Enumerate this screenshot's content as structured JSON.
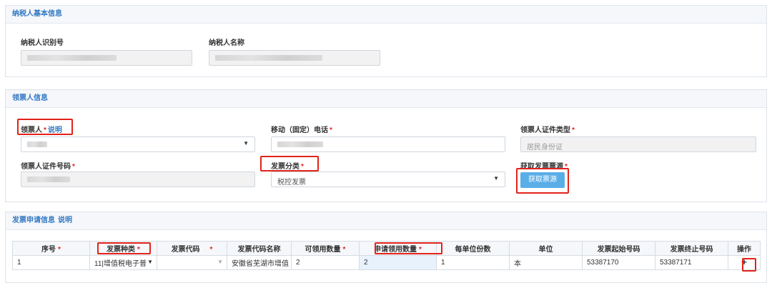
{
  "panels": {
    "taxpayer": {
      "title": "纳税人基本信息",
      "id_label": "纳税人识别号",
      "name_label": "纳税人名称"
    },
    "collector": {
      "title": "领票人信息",
      "collector_label": "领票人",
      "collector_note": "说明",
      "phone_label": "移动（固定）电话",
      "id_type_label": "领票人证件类型",
      "id_type_value": "居民身份证",
      "id_number_label": "领票人证件号码",
      "invoice_category_label": "发票分类",
      "invoice_category_value": "税控发票",
      "source_label": "获取发票票源",
      "source_button": "获取票源",
      "required_mark": "*"
    },
    "application": {
      "title": "发票申请信息",
      "title_link": "说明",
      "columns": [
        "序号",
        "发票种类",
        "发票代码",
        "发票代码名称",
        "可领用数量",
        "申请领用数量",
        "每单位份数",
        "单位",
        "发票起始号码",
        "发票终止号码",
        "操作"
      ],
      "rows": [
        {
          "index": "1",
          "invoice_type": "11|增值税电子普",
          "invoice_code": "",
          "code_name": "安徽省芜湖市增值",
          "available": "2",
          "requested": "2",
          "per_unit": "1",
          "unit": "本",
          "start_no": "53387170",
          "end_no": "53387171",
          "action": "+"
        }
      ]
    }
  },
  "colors": {
    "accent": "#3278c4",
    "required": "#e2231a",
    "button": "#5aaee8",
    "highlight_box": "#e2231a"
  }
}
